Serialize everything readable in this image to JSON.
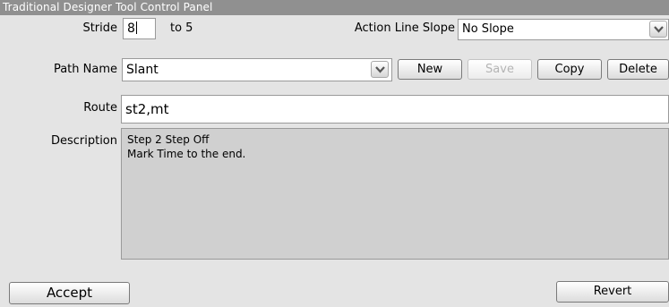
{
  "window": {
    "title": "Traditional Designer Tool Control Panel"
  },
  "stride": {
    "label": "Stride",
    "value": "8",
    "to_text": "to 5"
  },
  "action_line_slope": {
    "label": "Action Line Slope",
    "selected": "No Slope"
  },
  "path_name": {
    "label": "Path Name",
    "selected": "Slant"
  },
  "buttons": {
    "new": "New",
    "save": "Save",
    "copy": "Copy",
    "delete": "Delete",
    "accept": "Accept",
    "revert": "Revert"
  },
  "route": {
    "label": "Route",
    "value": "st2,mt"
  },
  "description": {
    "label": "Description",
    "lines": [
      "Step 2 Step Off",
      "Mark Time to the end."
    ]
  },
  "icons": {
    "dropdown": "chevron-down-icon"
  }
}
